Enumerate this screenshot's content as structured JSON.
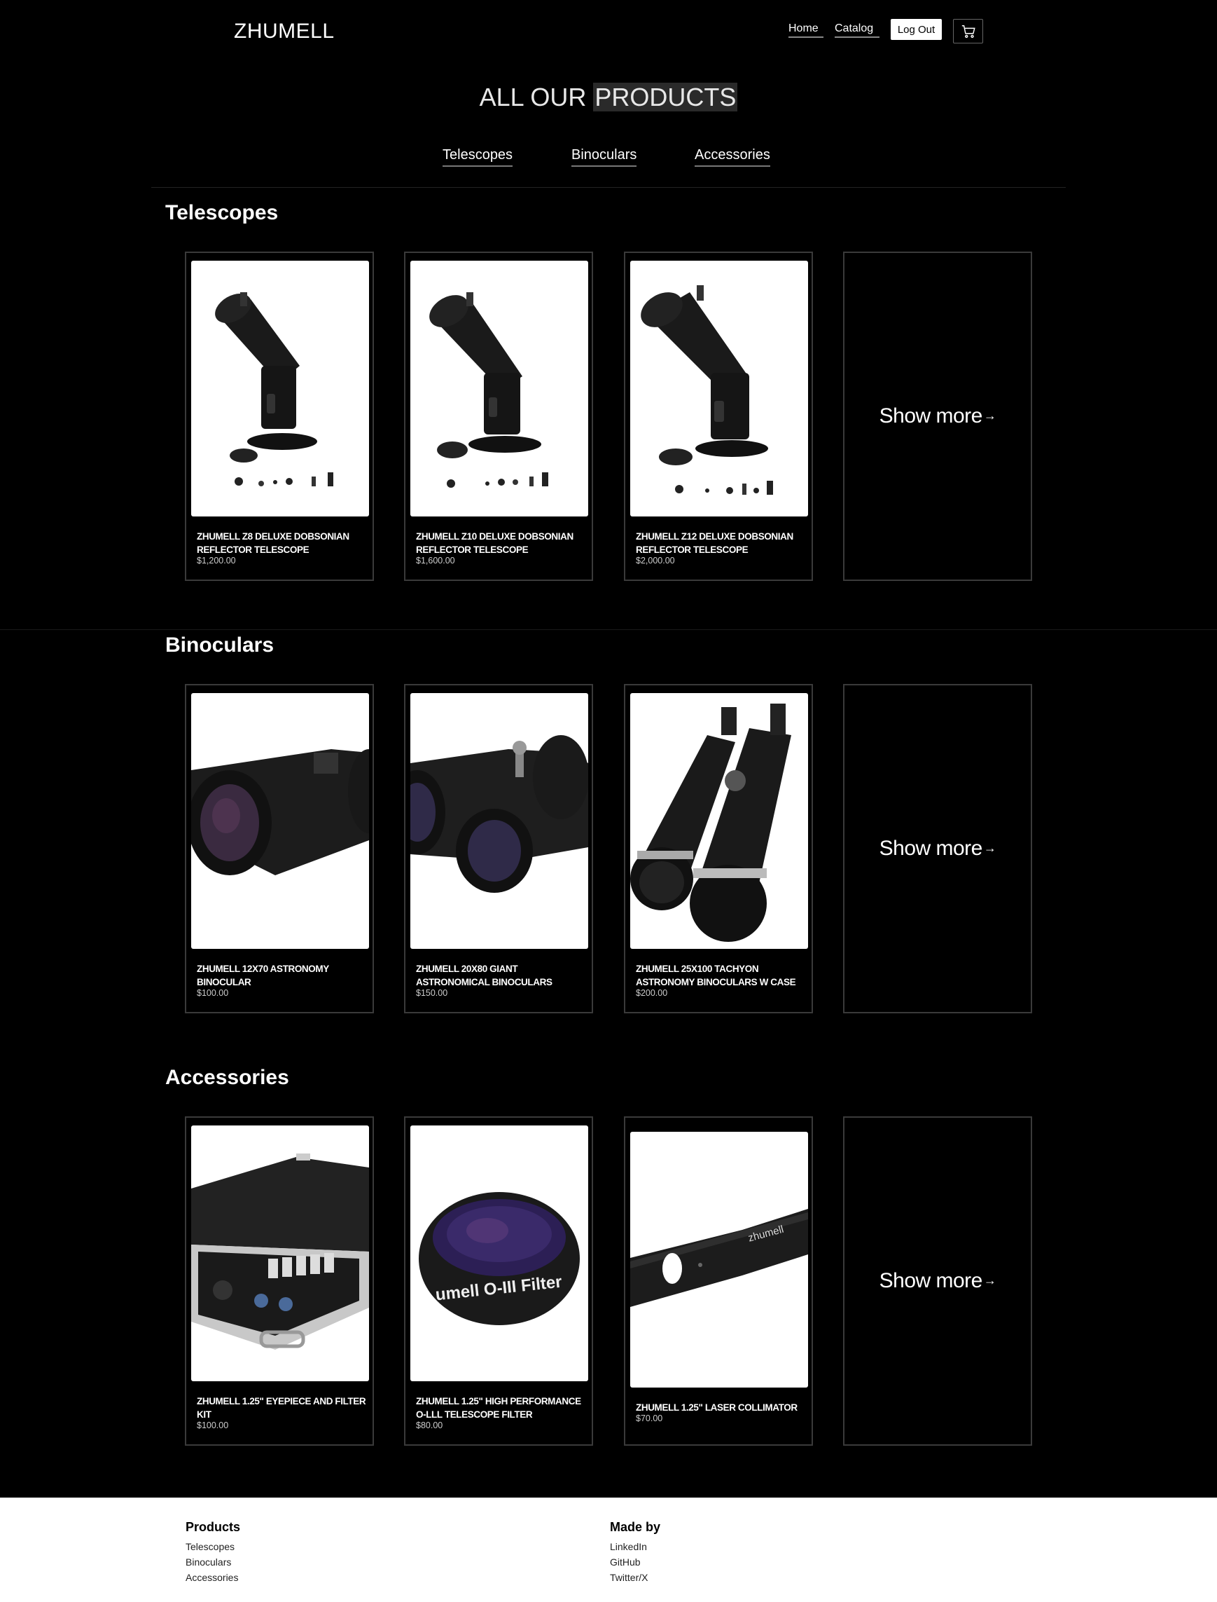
{
  "header": {
    "logo": "ZHUMELL",
    "nav": {
      "home": "Home",
      "catalog": "Catalog",
      "logout": "Log Out"
    },
    "cart_icon": "cart-icon"
  },
  "page_title": {
    "part1": "ALL OUR",
    "part2": "PRODUCTS"
  },
  "tabs": [
    "Telescopes",
    "Binoculars",
    "Accessories"
  ],
  "sections": [
    {
      "title": "Telescopes",
      "products": [
        {
          "name": "ZHUMELL Z8 DELUXE DOBSONIAN REFLECTOR TELESCOPE",
          "price": "$1,200.00",
          "image": "dobsonian-telescope"
        },
        {
          "name": "ZHUMELL Z10 DELUXE DOBSONIAN REFLECTOR TELESCOPE",
          "price": "$1,600.00",
          "image": "dobsonian-telescope"
        },
        {
          "name": "ZHUMELL Z12 DELUXE DOBSONIAN REFLECTOR TELESCOPE",
          "price": "$2,000.00",
          "image": "dobsonian-telescope"
        }
      ],
      "show_more": "Show more"
    },
    {
      "title": "Binoculars",
      "products": [
        {
          "name": "ZHUMELL 12X70 ASTRONOMY BINOCULAR",
          "price": "$100.00",
          "image": "binocular-closeup"
        },
        {
          "name": "ZHUMELL 20X80 GIANT ASTRONOMICAL BINOCULARS",
          "price": "$150.00",
          "image": "giant-binoculars"
        },
        {
          "name": "ZHUMELL 25X100 TACHYON ASTRONOMY BINOCULARS W CASE",
          "price": "$200.00",
          "image": "tachyon-binoculars"
        }
      ],
      "show_more": "Show more"
    },
    {
      "title": "Accessories",
      "products": [
        {
          "name": "ZHUMELL 1.25\" EYEPIECE AND FILTER KIT",
          "price": "$100.00",
          "image": "eyepiece-kit-case"
        },
        {
          "name": "ZHUMELL 1.25\" HIGH PERFORMANCE O-LLL TELESCOPE FILTER",
          "price": "$80.00",
          "image": "oiii-filter",
          "image_text": "umell O-III Filter"
        },
        {
          "name": "ZHUMELL 1.25\" LASER COLLIMATOR",
          "price": "$70.00",
          "image": "laser-collimator",
          "image_text": "zhumell"
        }
      ],
      "show_more": "Show more"
    }
  ],
  "footer": {
    "products": {
      "heading": "Products",
      "links": [
        "Telescopes",
        "Binoculars",
        "Accessories"
      ]
    },
    "made_by": {
      "heading": "Made by",
      "links": [
        "LinkedIn",
        "GitHub",
        "Twitter/X"
      ]
    }
  }
}
